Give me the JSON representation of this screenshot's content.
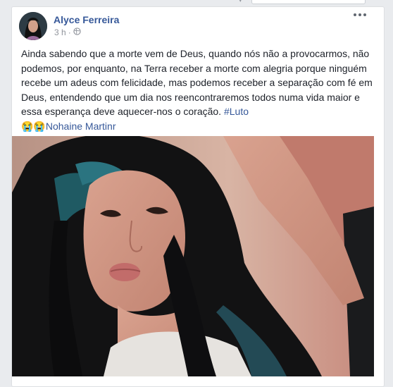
{
  "post": {
    "author": "Alyce Ferreira",
    "time": "3 h",
    "privacy_icon": "globe-icon",
    "text_main": "Ainda sabendo que a morte vem de Deus, quando nós não a provocarmos, não podemos, por enquanto, na Terra receber a morte com alegria porque ninguém recebe um adeus com felicidade, mas podemos receber a separação com fé em Deus, entendendo que um dia nos reencontraremos todos numa vida maior e essa esperança deve aquecer-nos o coração.",
    "hashtag": "#Luto",
    "emoji": "😭😭",
    "tagged_name": "Nohaine Martinr",
    "more_icon": "more-options-icon"
  },
  "colors": {
    "link": "#365899",
    "text": "#1d2129",
    "meta": "#90949c"
  }
}
